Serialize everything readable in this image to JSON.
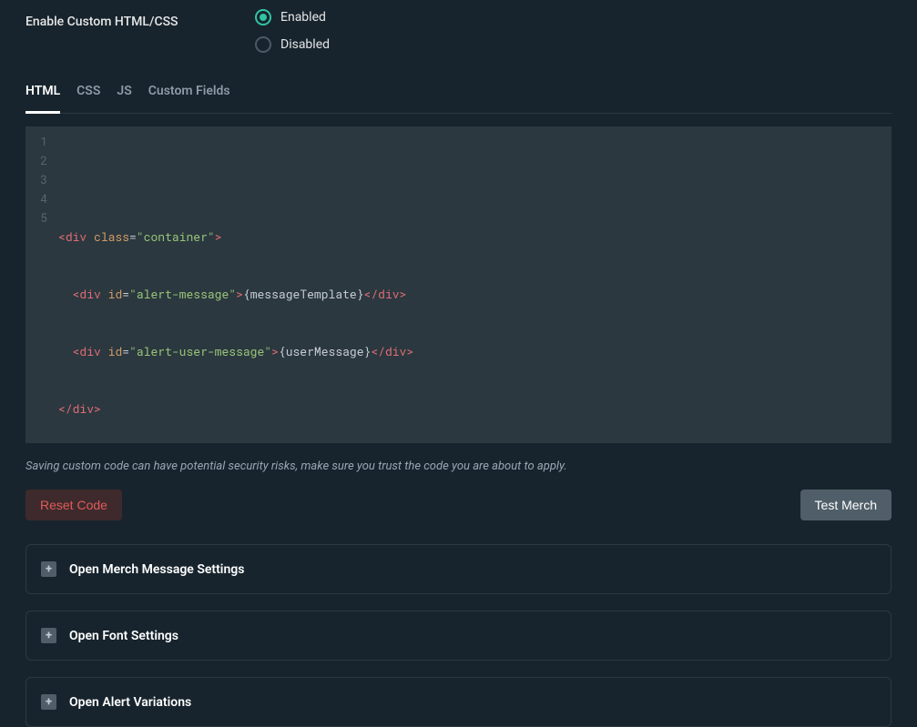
{
  "setting": {
    "label": "Enable Custom HTML/CSS",
    "options": {
      "enabled": "Enabled",
      "disabled": "Disabled"
    },
    "selected": "enabled"
  },
  "tabs": [
    "HTML",
    "CSS",
    "JS",
    "Custom Fields"
  ],
  "active_tab": 0,
  "code_lines": [
    "1",
    "2",
    "3",
    "4",
    "5"
  ],
  "code": {
    "l2": {
      "tag": "div",
      "attr": "class",
      "val": "\"container\""
    },
    "l3": {
      "indent": "  ",
      "tag": "div",
      "attr": "id",
      "val": "\"alert-message\"",
      "text": "{messageTemplate}",
      "close": "div"
    },
    "l4": {
      "indent": "  ",
      "tag": "div",
      "attr": "id",
      "val": "\"alert-user-message\"",
      "text": "{userMessage}",
      "close": "div"
    },
    "l5": {
      "close": "div"
    }
  },
  "warning": "Saving custom code can have potential security risks, make sure you trust the code you are about to apply.",
  "buttons": {
    "reset": "Reset Code",
    "test": "Test Merch"
  },
  "accordions": [
    "Open Merch Message Settings",
    "Open Font Settings",
    "Open Alert Variations"
  ]
}
